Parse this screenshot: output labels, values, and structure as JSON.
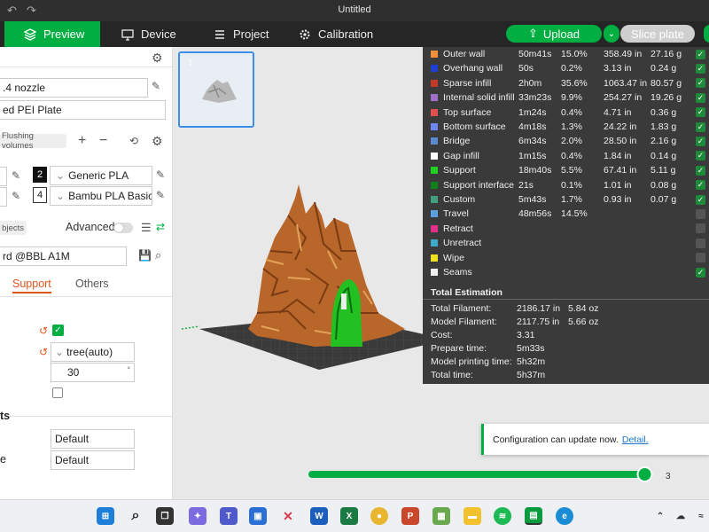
{
  "window": {
    "title": "Untitled"
  },
  "tabs": [
    {
      "label": "Preview",
      "active": true
    },
    {
      "label": "Device"
    },
    {
      "label": "Project"
    },
    {
      "label": "Calibration"
    }
  ],
  "toolbar": {
    "upload_label": "Upload",
    "slice_label": "Slice plate"
  },
  "left": {
    "nozzle": ".4 nozzle",
    "plate": "ed PEI Plate",
    "flushing_label": "Flushing volumes",
    "filaments": [
      {
        "num": "2",
        "name": "Generic PLA"
      },
      {
        "num": "4",
        "name": "Bambu PLA Basic"
      }
    ],
    "objects_label": "bjects",
    "advanced_label": "Advanced",
    "process": "rd @BBL A1M",
    "settings_tabs": [
      "Support",
      "Others"
    ],
    "support_type": "tree(auto)",
    "threshold_angle": "30",
    "angle_unit": "°",
    "section_label": "ts",
    "default1_label": "",
    "default1": "Default",
    "default2_label": "e",
    "default2": "Default"
  },
  "stats": {
    "rows": [
      {
        "name": "Outer wall",
        "time": "50m41s",
        "pct": "15.0%",
        "len": "358.49 in",
        "wt": "27.16 g",
        "color": "#f28f3b",
        "checked": true
      },
      {
        "name": "Overhang wall",
        "time": "50s",
        "pct": "0.2%",
        "len": "3.13 in",
        "wt": "0.24 g",
        "color": "#2040d0",
        "checked": true
      },
      {
        "name": "Sparse infill",
        "time": "2h0m",
        "pct": "35.6%",
        "len": "1063.47 in",
        "wt": "80.57 g",
        "color": "#c0392b",
        "checked": true
      },
      {
        "name": "Internal solid infill",
        "time": "33m23s",
        "pct": "9.9%",
        "len": "254.27 in",
        "wt": "19.26 g",
        "color": "#a070c8",
        "checked": true
      },
      {
        "name": "Top surface",
        "time": "1m24s",
        "pct": "0.4%",
        "len": "4.71 in",
        "wt": "0.36 g",
        "color": "#e05050",
        "checked": true
      },
      {
        "name": "Bottom surface",
        "time": "4m18s",
        "pct": "1.3%",
        "len": "24.22 in",
        "wt": "1.83 g",
        "color": "#6e86f0",
        "checked": true
      },
      {
        "name": "Bridge",
        "time": "6m34s",
        "pct": "2.0%",
        "len": "28.50 in",
        "wt": "2.16 g",
        "color": "#5a8ad0",
        "checked": true
      },
      {
        "name": "Gap infill",
        "time": "1m15s",
        "pct": "0.4%",
        "len": "1.84 in",
        "wt": "0.14 g",
        "color": "#ffffff",
        "checked": true
      },
      {
        "name": "Support",
        "time": "18m40s",
        "pct": "5.5%",
        "len": "67.41 in",
        "wt": "5.11 g",
        "color": "#22d022",
        "checked": true
      },
      {
        "name": "Support interface",
        "time": "21s",
        "pct": "0.1%",
        "len": "1.01 in",
        "wt": "0.08 g",
        "color": "#10801a",
        "checked": true
      },
      {
        "name": "Custom",
        "time": "5m43s",
        "pct": "1.7%",
        "len": "0.93 in",
        "wt": "0.07 g",
        "color": "#40a080",
        "checked": true
      },
      {
        "name": "Travel",
        "time": "48m56s",
        "pct": "14.5%",
        "len": "",
        "wt": "",
        "color": "#5aa0e0",
        "checked": false
      },
      {
        "name": "Retract",
        "time": "",
        "pct": "",
        "len": "",
        "wt": "",
        "color": "#e0308a",
        "checked": false
      },
      {
        "name": "Unretract",
        "time": "",
        "pct": "",
        "len": "",
        "wt": "",
        "color": "#40a8c8",
        "checked": false
      },
      {
        "name": "Wipe",
        "time": "",
        "pct": "",
        "len": "",
        "wt": "",
        "color": "#f0e020",
        "checked": false
      },
      {
        "name": "Seams",
        "time": "",
        "pct": "",
        "len": "",
        "wt": "",
        "color": "#f0f0f0",
        "checked": true
      }
    ],
    "total_title": "Total Estimation",
    "totals": [
      {
        "label": "Total Filament:",
        "v1": "2186.17 in",
        "v2": "5.84 oz"
      },
      {
        "label": "Model Filament:",
        "v1": "2117.75 in",
        "v2": "5.66 oz"
      },
      {
        "label": "Cost:",
        "v1": "3.31",
        "v2": ""
      },
      {
        "label": "Prepare time:",
        "v1": "5m33s",
        "v2": ""
      },
      {
        "label": "Model printing time:",
        "v1": "5h32m",
        "v2": ""
      },
      {
        "label": "Total time:",
        "v1": "5h37m",
        "v2": ""
      }
    ]
  },
  "notification": {
    "text": "Configuration can update now.",
    "link": "Detail."
  },
  "layer_slider": {
    "value": "3",
    "fraction": 0.96
  },
  "thumbnail": {
    "index": "1"
  }
}
